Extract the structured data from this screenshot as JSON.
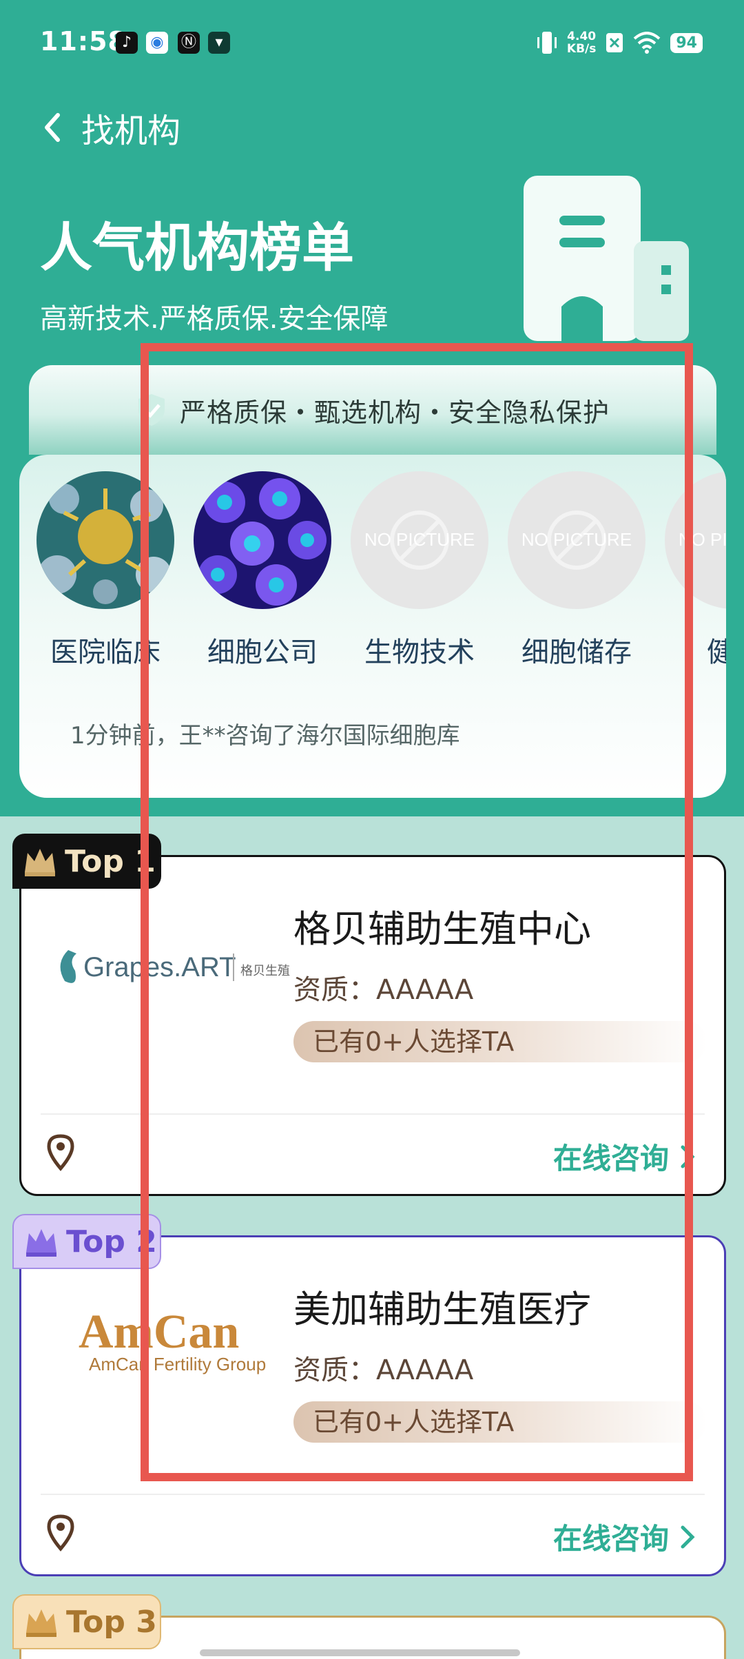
{
  "status_bar": {
    "time": "11:58",
    "network_speed_value": "4.40",
    "network_speed_unit": "KB/s",
    "battery": "94",
    "app_icons": [
      "tiktok-icon",
      "app-badge-icon",
      "n-icon",
      "message-icon"
    ]
  },
  "nav": {
    "title": "找机构"
  },
  "hero": {
    "title": "人气机构榜单",
    "subtitle": "高新技术.严格质保.安全保障"
  },
  "banner": {
    "text": "严格质保・甄选机构・安全隐私保护"
  },
  "categories": [
    {
      "label": "医院临床",
      "image": "cell-microscopy"
    },
    {
      "label": "细胞公司",
      "image": "blue-cells"
    },
    {
      "label": "生物技术",
      "image": "no-picture",
      "placeholder": "NO PICTURE"
    },
    {
      "label": "细胞储存",
      "image": "no-picture",
      "placeholder": "NO PICTURE"
    },
    {
      "label": "健...",
      "image": "no-picture",
      "placeholder": "NO PICTURE"
    }
  ],
  "marquee": "1分钟前，王**咨询了海尔国际细胞库",
  "orgs": [
    {
      "rank": "Top 1",
      "logo_text": "Grapes.ART",
      "logo_cn": "格贝生殖",
      "name": "格贝辅助生殖中心",
      "qualification": "资质：AAAAA",
      "chosen": "已有0+人选择TA",
      "consult": "在线咨询"
    },
    {
      "rank": "Top 2",
      "logo_text": "AmCan",
      "logo_sub": "AmCan Fertility Group",
      "name": "美加辅助生殖医疗",
      "qualification": "资质：AAAAA",
      "chosen": "已有0+人选择TA",
      "consult": "在线咨询"
    },
    {
      "rank": "Top 3"
    }
  ],
  "colors": {
    "primary": "#2fae95",
    "annotation": "#e8574f",
    "list_bg": "#b9e1d8"
  }
}
